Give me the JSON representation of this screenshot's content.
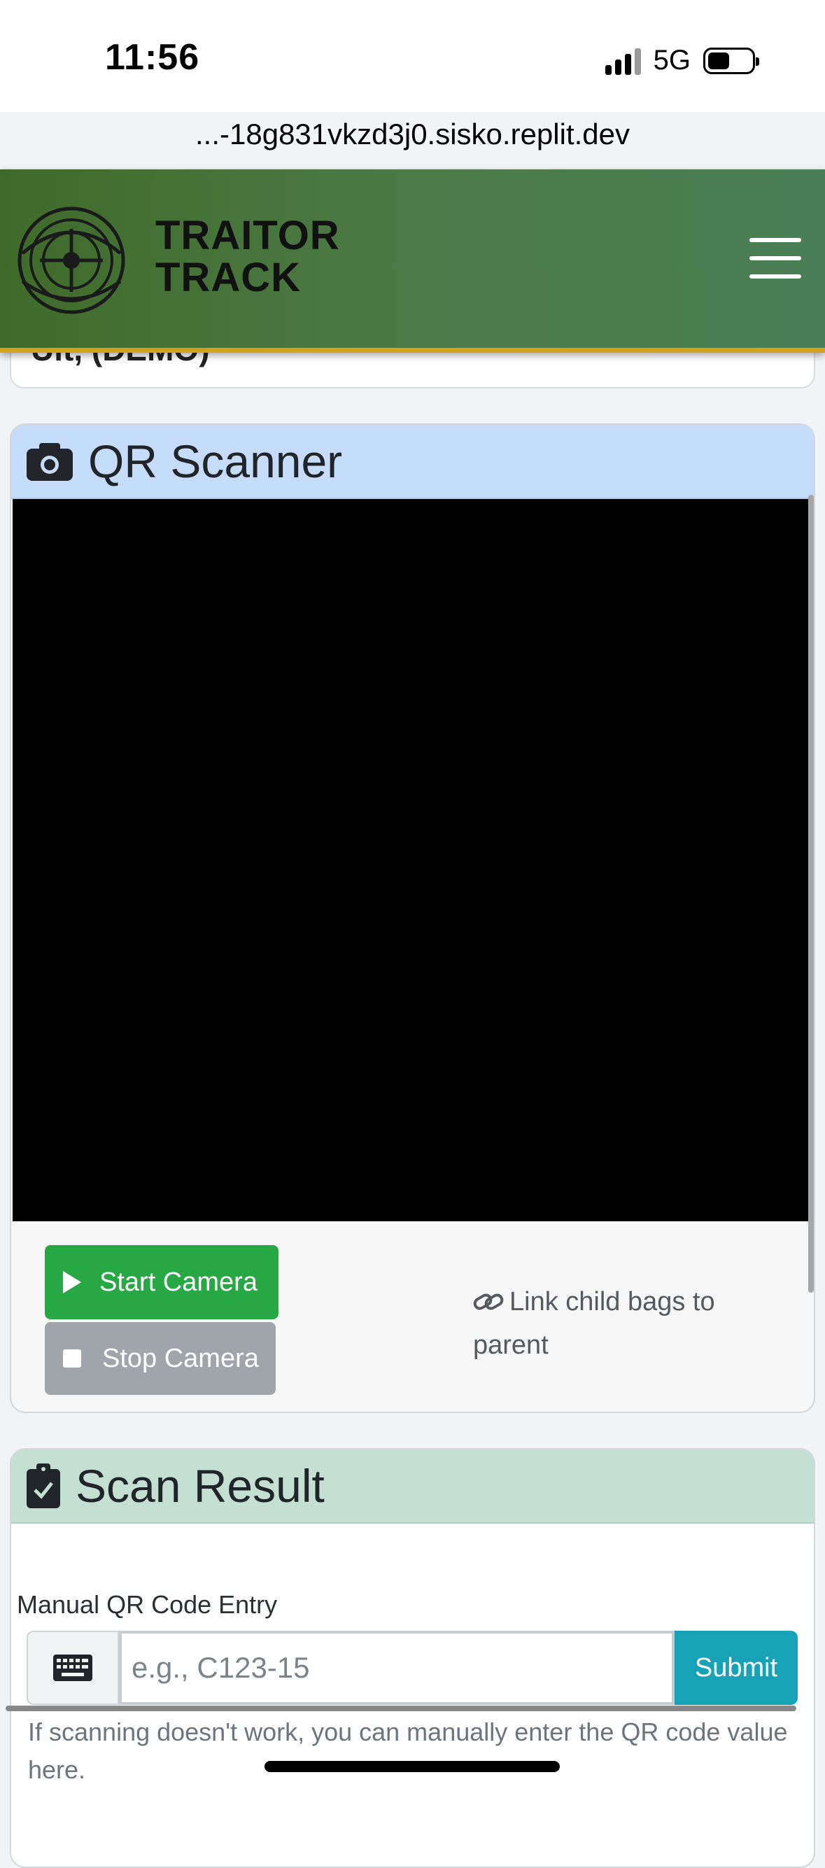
{
  "status_bar": {
    "time": "11:56",
    "network": "5G",
    "url": "...-18g831vkzd3j0.sisko.replit.dev"
  },
  "navbar": {
    "brand_line1": "TRAITOR",
    "brand_line2": "TRACK"
  },
  "previous_card": {
    "text": "Ult, (DEMO)"
  },
  "scanner": {
    "title": "QR Scanner",
    "start_label": "Start Camera",
    "stop_label": "Stop Camera",
    "link_text": "Link child bags to parent"
  },
  "result": {
    "title": "Scan Result",
    "manual_label": "Manual QR Code Entry",
    "input_placeholder": "e.g., C123-15",
    "submit_label": "Submit",
    "help_text": "If scanning doesn't work, you can manually enter the QR code value here."
  },
  "colors": {
    "navbar_accent": "#d4a21a",
    "start_button": "#28a745",
    "stop_button": "#a0a5ab",
    "submit_button": "#17a2b8",
    "scanner_header": "#c5dcfb",
    "result_header": "#c3e0d3"
  }
}
